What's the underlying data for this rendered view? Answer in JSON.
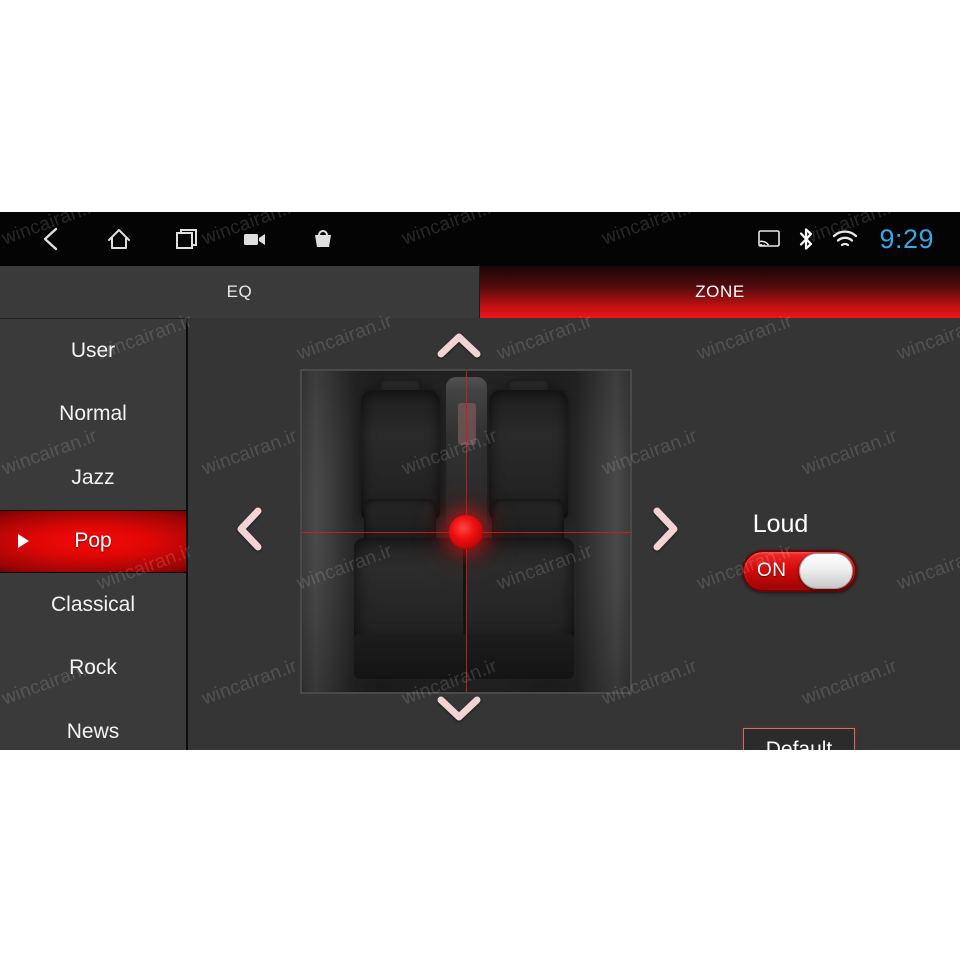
{
  "statusbar": {
    "nav": [
      {
        "name": "back-icon",
        "label": "Back"
      },
      {
        "name": "home-icon",
        "label": "Home"
      },
      {
        "name": "recents-icon",
        "label": "Recents"
      },
      {
        "name": "video-camera-icon",
        "label": "Camera"
      },
      {
        "name": "shopping-bag-icon",
        "label": "Apps"
      }
    ],
    "indicators": [
      {
        "name": "cast-icon",
        "label": "Cast"
      },
      {
        "name": "bluetooth-icon",
        "label": "Bluetooth"
      },
      {
        "name": "wifi-icon",
        "label": "Wi-Fi"
      }
    ],
    "clock": "9:29",
    "clock_color": "#35a8e8"
  },
  "tabs": [
    {
      "label": "EQ",
      "active": false
    },
    {
      "label": "ZONE",
      "active": true
    }
  ],
  "sidebar": {
    "items": [
      {
        "label": "User",
        "selected": false
      },
      {
        "label": "Normal",
        "selected": false
      },
      {
        "label": "Jazz",
        "selected": false
      },
      {
        "label": "Pop",
        "selected": true
      },
      {
        "label": "Classical",
        "selected": false
      },
      {
        "label": "Rock",
        "selected": false
      },
      {
        "label": "News",
        "selected": false
      }
    ],
    "selected": "Pop"
  },
  "zone": {
    "image_label": "car-interior-top-view",
    "position_marker": "sound-focus-dot",
    "arrows": [
      {
        "name": "zone-up-arrow",
        "glyph": "chevron-up"
      },
      {
        "name": "zone-down-arrow",
        "glyph": "chevron-down"
      },
      {
        "name": "zone-left-arrow",
        "glyph": "chevron-left"
      },
      {
        "name": "zone-right-arrow",
        "glyph": "chevron-right"
      }
    ]
  },
  "controls": {
    "loud_label": "Loud",
    "loud_state": "ON",
    "default_label": "Default"
  },
  "colors": {
    "accent_red": "#e00606",
    "active_tab_red": "#ee1417",
    "clock_blue": "#35a8e8",
    "screen_bg": "#353535",
    "statusbar_bg": "#040404"
  },
  "watermark": {
    "text": "wincairan.ir"
  }
}
